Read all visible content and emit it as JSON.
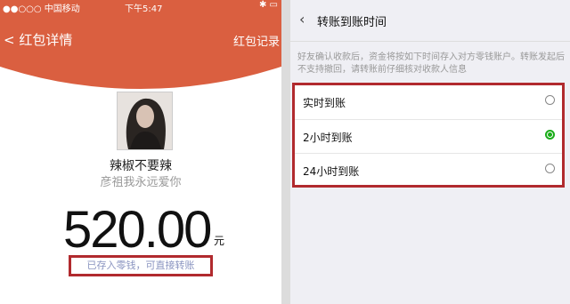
{
  "left": {
    "status": {
      "carrier": "●●○○○ 中国移动",
      "time": "下午5:47",
      "right": "✱ ▭"
    },
    "nav": {
      "back_title": "< 红包详情",
      "records": "红包记录"
    },
    "sender": {
      "name": "辣椒不要辣",
      "blessing": "彦祖我永远爱你"
    },
    "amount": {
      "value": "520.00",
      "unit": "元"
    },
    "tip": "已存入零钱，可直接转账"
  },
  "right": {
    "header": {
      "back_icon": "chevron-left-icon",
      "title": "转账到账时间"
    },
    "note": "好友确认收款后，资金将按如下时间存入对方零钱账户。转账发起后不支持撤回，请转账前仔细核对收款人信息",
    "options": [
      {
        "label": "实时到账",
        "selected": false
      },
      {
        "label": "2小时到账",
        "selected": true
      },
      {
        "label": "24小时到账",
        "selected": false
      }
    ]
  },
  "colors": {
    "header_red": "#da5f40",
    "highlight_border": "#b12a2e",
    "radio_green": "#1aad19"
  }
}
